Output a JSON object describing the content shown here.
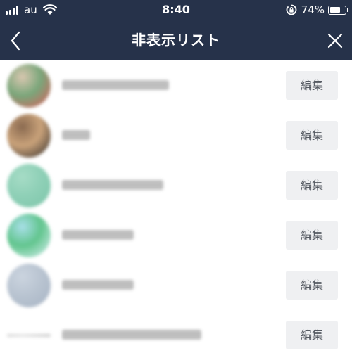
{
  "status_bar": {
    "carrier": "au",
    "time": "8:40",
    "battery": "74%",
    "battery_level": 0.74
  },
  "nav": {
    "title": "非表示リスト",
    "back_icon": "chevron-left-icon",
    "close_icon": "close-icon"
  },
  "colors": {
    "header_bg": "#26324a",
    "edit_button_bg": "#eff0f2"
  },
  "hidden_list": [
    {
      "name": "",
      "avatar_colors": [
        "#7aa67a",
        "#d9c7b0",
        "#e05a5a"
      ],
      "edit_label": "編集"
    },
    {
      "name": "",
      "avatar_colors": [
        "#c9a27a",
        "#8a6a50",
        "#2e2a28"
      ],
      "edit_label": "編集"
    },
    {
      "name": "",
      "avatar_colors": [
        "#8fd0b7",
        "#a6dcc6",
        "#7cc5a9"
      ],
      "edit_label": "編集"
    },
    {
      "name": "",
      "avatar_colors": [
        "#62c58e",
        "#a8dfe8",
        "#dff3f7"
      ],
      "edit_label": "編集"
    },
    {
      "name": "",
      "avatar_colors": [
        "#b9c4d1",
        "#cbd4df",
        "#a6b3c3"
      ],
      "edit_label": "編集"
    },
    {
      "name": "",
      "avatar_colors": [
        "#d9d9d9",
        "#e4e4e4",
        "#cccccc"
      ],
      "edit_label": "編集"
    }
  ]
}
